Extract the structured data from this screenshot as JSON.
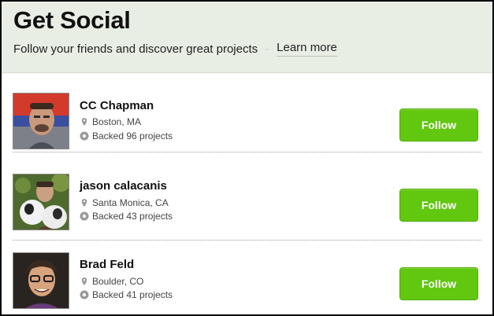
{
  "header": {
    "title": "Get Social",
    "subtitle": "Follow your friends and discover great projects",
    "separator": "·",
    "learn_more": "Learn more"
  },
  "people": [
    {
      "name": "CC Chapman",
      "location": "Boston, MA",
      "backed": "Backed 96 projects",
      "follow_label": "Follow"
    },
    {
      "name": "jason calacanis",
      "location": "Santa Monica, CA",
      "backed": "Backed 43 projects",
      "follow_label": "Follow"
    },
    {
      "name": "Brad Feld",
      "location": "Boulder, CO",
      "backed": "Backed 41 projects",
      "follow_label": "Follow"
    }
  ],
  "colors": {
    "header_bg": "#e9eee4",
    "follow_button": "#62c70f"
  },
  "icons": {
    "location": "map-pin-icon",
    "backed": "gear-badge-icon"
  }
}
